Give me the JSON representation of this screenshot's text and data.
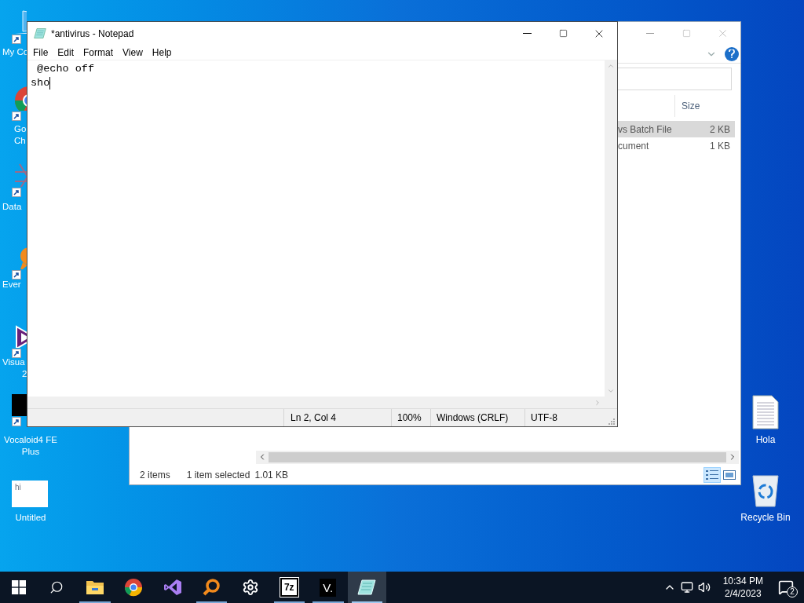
{
  "desktop_icons_left": [
    {
      "kind": "pc",
      "lines": [
        "My Co"
      ]
    },
    {
      "kind": "chrome",
      "lines": [
        "Go",
        "Ch"
      ]
    },
    {
      "kind": "dataw",
      "lines": [
        "Data"
      ]
    },
    {
      "kind": "ever",
      "lines": [
        "Ever"
      ]
    },
    {
      "kind": "vs",
      "lines": [
        "Visua",
        "2"
      ]
    },
    {
      "kind": "vocaloid",
      "lines": [
        "Vocaloid4 FE",
        "Plus"
      ]
    },
    {
      "kind": "thumb",
      "lines": [
        "Untitled"
      ],
      "preview_text": "hi"
    }
  ],
  "desktop_icons_right": [
    {
      "kind": "document",
      "label": "Hola"
    },
    {
      "kind": "recycle",
      "label": "Recycle Bin"
    }
  ],
  "explorer": {
    "columns": [
      "Size"
    ],
    "rows": [
      {
        "type": "vs Batch File",
        "size": "2 KB",
        "selected": true
      },
      {
        "type": "cument",
        "size": "1 KB",
        "selected": false
      }
    ],
    "status": {
      "count": "2 items",
      "selection": "1 item selected",
      "size": "1.01 KB"
    },
    "views": [
      {
        "kind": "details",
        "selected": true
      },
      {
        "kind": "thumbnails",
        "selected": false
      }
    ]
  },
  "notepad": {
    "title": "*antivirus - Notepad",
    "menu": [
      "File",
      "Edit",
      "Format",
      "View",
      "Help"
    ],
    "lines": [
      " @echo off",
      "sho"
    ],
    "status": {
      "position": "Ln 2, Col 4",
      "zoom": "100%",
      "line_endings": "Windows (CRLF)",
      "encoding": "UTF-8"
    }
  },
  "taskbar": {
    "apps": [
      {
        "kind": "explorer",
        "running": true,
        "selected": false
      },
      {
        "kind": "chrome",
        "running": false,
        "selected": false
      },
      {
        "kind": "vs",
        "running": false,
        "selected": false
      },
      {
        "kind": "magnifier",
        "running": true,
        "selected": false
      },
      {
        "kind": "gear",
        "running": false,
        "selected": false
      },
      {
        "kind": "sevenzip",
        "running": true,
        "selected": false,
        "glyph": "7z"
      },
      {
        "kind": "vapp",
        "running": true,
        "selected": false,
        "glyph": "V."
      },
      {
        "kind": "notepad",
        "running": true,
        "selected": true
      }
    ],
    "clock": {
      "time": "10:34 PM",
      "date": "2/4/2023"
    },
    "notifications": "2"
  }
}
